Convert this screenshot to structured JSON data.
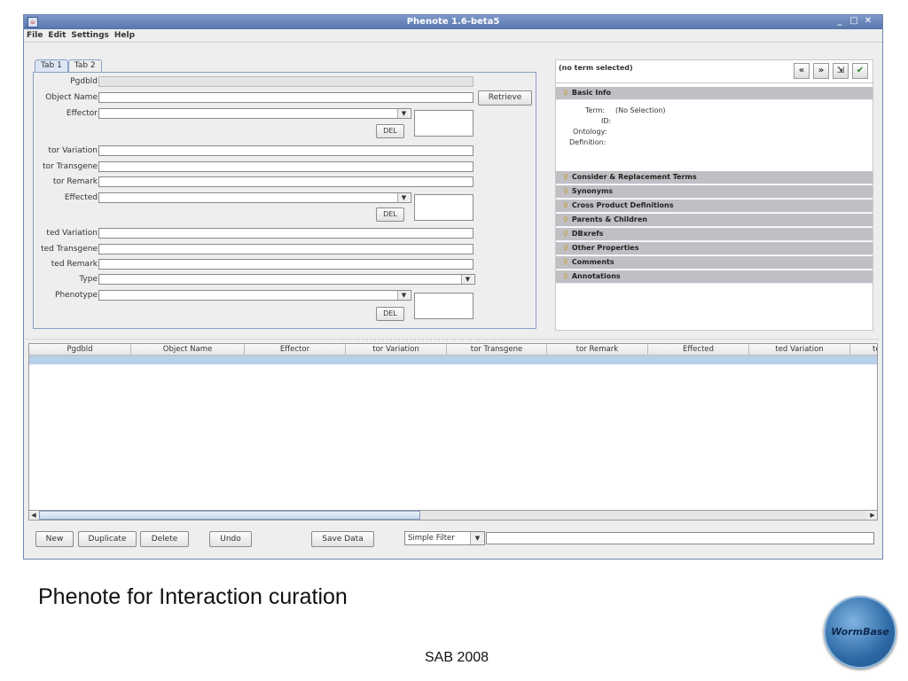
{
  "window": {
    "title": "Phenote 1.6-beta5",
    "controls": [
      "_",
      "□",
      "✕"
    ]
  },
  "menu": [
    "File",
    "Edit",
    "Settings",
    "Help"
  ],
  "tabs": [
    "Tab 1",
    "Tab 2"
  ],
  "form": {
    "pgdbid": "Pgdbld",
    "object_name": "Object Name",
    "retrieve": "Retrieve",
    "effector": "Effector",
    "del": "DEL",
    "tor_variation": "tor Variation",
    "tor_transgene": "tor Transgene",
    "tor_remark": "tor Remark",
    "effected": "Effected",
    "ted_variation": "ted Variation",
    "ted_transgene": "ted Transgene",
    "ted_remark": "ted Remark",
    "type": "Type",
    "phenotype": "Phenotype"
  },
  "term_panel": {
    "header": "(no term selected)",
    "basic_info": "Basic Info",
    "term_label": "Term:",
    "term_value": "(No Selection)",
    "id_label": "ID:",
    "ontology_label": "Ontology:",
    "definition_label": "Definition:",
    "sections": [
      "Consider & Replacement Terms",
      "Synonyms",
      "Cross Product Definitions",
      "Parents & Children",
      "DBxrefs",
      "Other Properties",
      "Comments",
      "Annotations"
    ]
  },
  "table": {
    "columns": [
      "Pgdbld",
      "Object Name",
      "Effector",
      "tor Variation",
      "tor Transgene",
      "tor Remark",
      "Effected",
      "ted Variation",
      "te"
    ]
  },
  "buttons": {
    "new": "New",
    "duplicate": "Duplicate",
    "delete": "Delete",
    "undo": "Undo",
    "save": "Save Data",
    "filter": "Simple Filter"
  },
  "caption": "Phenote for Interaction curation",
  "footer": "SAB 2008",
  "logo_text": "WormBase"
}
